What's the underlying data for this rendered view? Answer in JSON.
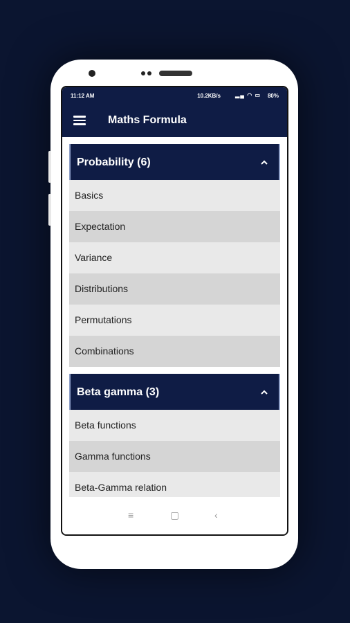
{
  "status_bar": {
    "time": "11:12 AM",
    "network_speed": "10.2KB/s",
    "icons": [
      "signal-icon",
      "volte-icon",
      "signal-icon",
      "wifi-icon",
      "battery-icon"
    ],
    "battery": "80%"
  },
  "app_bar": {
    "title": "Maths Formula",
    "menu_icon": "hamburger-icon"
  },
  "sections": [
    {
      "title": "Probability (6)",
      "expanded": true,
      "items": [
        "Basics",
        "Expectation",
        "Variance",
        "Distributions",
        "Permutations",
        "Combinations"
      ]
    },
    {
      "title": "Beta gamma (3)",
      "expanded": true,
      "items": [
        "Beta functions",
        "Gamma functions",
        "Beta-Gamma relation"
      ]
    }
  ],
  "nav_bar": {
    "buttons": [
      "menu-icon",
      "home-icon",
      "back-icon"
    ]
  },
  "colors": {
    "primary": "#0f1c45",
    "background": "#0b1530",
    "item_light": "#e9e9e9",
    "item_dark": "#d5d5d5"
  }
}
